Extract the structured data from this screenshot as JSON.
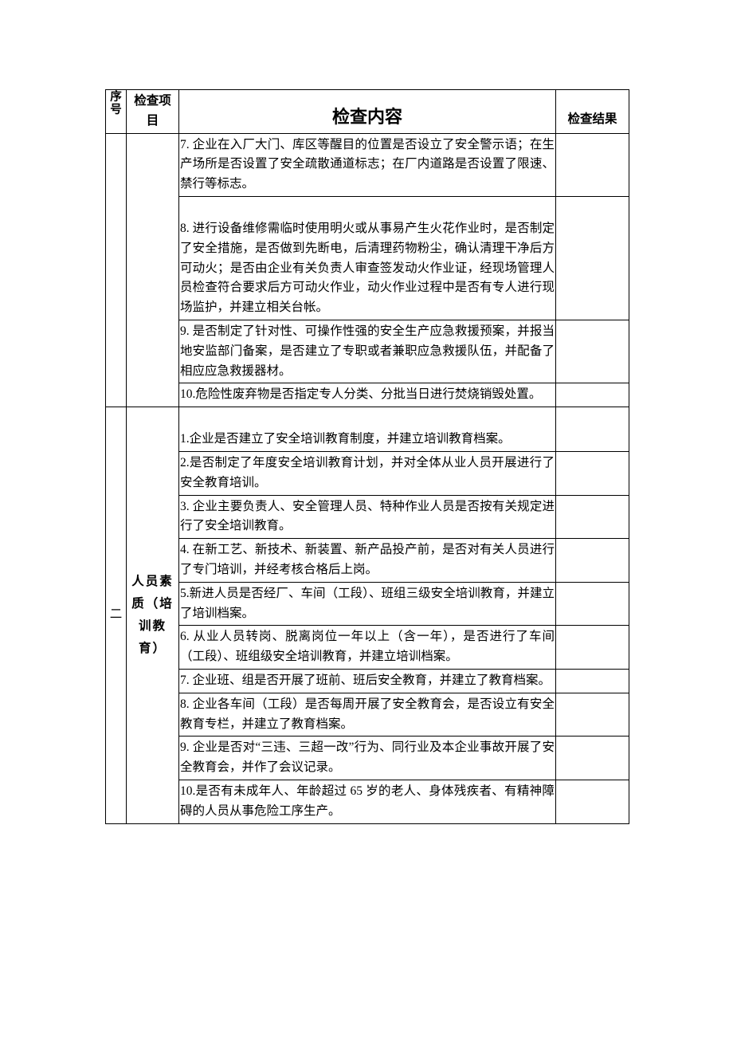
{
  "headers": {
    "sequence": "序号",
    "item": "检查项目",
    "content": "检查内容",
    "result": "检查结果"
  },
  "sections": [
    {
      "seq": "",
      "item": "",
      "rows": [
        {
          "content": "7. 企业在入厂大门、库区等醒目的位置是否设立了安全警示语；在生产场所是否设置了安全疏散通道标志；在厂内道路是否设置了限速、禁行等标志。",
          "padTop": false
        },
        {
          "content": "8. 进行设备维修需临时使用明火或从事易产生火花作业时，是否制定了安全措施，是否做到先断电，后清理药物粉尘，确认清理干净后方可动火；是否由企业有关负责人审查签发动火作业证，经现场管理人员检查符合要求后方可动火作业，动火作业过程中是否有专人进行现场监护，并建立相关台帐。",
          "padTop": true
        },
        {
          "content": "9. 是否制定了针对性、可操作性强的安全生产应急救援预案，并报当地安监部门备案，是否建立了专职或者兼职应急救援队伍，并配备了相应应急救援器材。",
          "padTop": false
        },
        {
          "content": "10.危险性废弃物是否指定专人分类、分批当日进行焚烧销毁处置。",
          "padTop": false
        }
      ]
    },
    {
      "seq": "二",
      "item": "人员素质（培训教育）",
      "rows": [
        {
          "content": "1.企业是否建立了安全培训教育制度，并建立培训教育档案。",
          "padTop": true
        },
        {
          "content": "2.是否制定了年度安全培训教育计划，并对全体从业人员开展进行了安全教育培训。",
          "padTop": false
        },
        {
          "content": "3. 企业主要负责人、安全管理人员、特种作业人员是否按有关规定进行了安全培训教育。",
          "padTop": false
        },
        {
          "content": "4. 在新工艺、新技术、新装置、新产品投产前，是否对有关人员进行了专门培训，并经考核合格后上岗。",
          "padTop": false
        },
        {
          "content": "5.新进人员是否经厂、车间（工段）、班组三级安全培训教育，并建立了培训档案。",
          "padTop": false
        },
        {
          "content": "6. 从业人员转岗、脱离岗位一年以上（含一年），是否进行了车间（工段）、班组级安全培训教育，并建立培训档案。",
          "padTop": false
        },
        {
          "content": "7. 企业班、组是否开展了班前、班后安全教育，并建立了教育档案。",
          "padTop": false
        },
        {
          "content": "8. 企业各车间（工段）是否每周开展了安全教育会，是否设立有安全教育专栏，并建立了教育档案。",
          "padTop": false
        },
        {
          "content": "9. 企业是否对“三违、三超一改”行为、同行业及本企业事故开展了安全教育会，并作了会议记录。",
          "padTop": false
        },
        {
          "content": "10.是否有未成年人、年龄超过 65 岁的老人、身体残疾者、有精神障碍的人员从事危险工序生产。",
          "padTop": false
        }
      ]
    }
  ]
}
